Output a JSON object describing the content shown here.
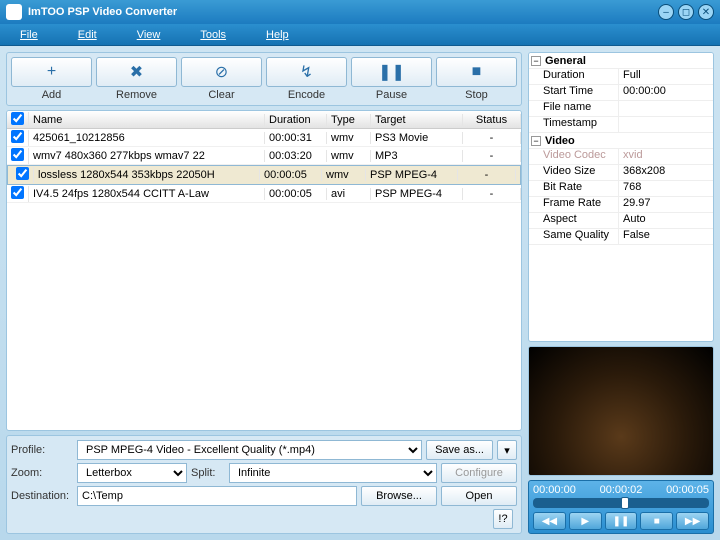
{
  "title": "ImTOO PSP Video Converter",
  "menu": [
    "File",
    "Edit",
    "View",
    "Tools",
    "Help"
  ],
  "tools": [
    {
      "icon": "+",
      "label": "Add"
    },
    {
      "icon": "✖",
      "label": "Remove"
    },
    {
      "icon": "⊘",
      "label": "Clear"
    },
    {
      "icon": "↯",
      "label": "Encode"
    },
    {
      "icon": "❚❚",
      "label": "Pause"
    },
    {
      "icon": "■",
      "label": "Stop"
    }
  ],
  "list": {
    "headers": {
      "name": "Name",
      "duration": "Duration",
      "type": "Type",
      "target": "Target",
      "status": "Status"
    },
    "rows": [
      {
        "checked": true,
        "name": "425061_10212856",
        "duration": "00:00:31",
        "type": "wmv",
        "target": "PS3 Movie",
        "status": "-"
      },
      {
        "checked": true,
        "name": "wmv7 480x360 277kbps wmav7 22",
        "duration": "00:03:20",
        "type": "wmv",
        "target": "MP3",
        "status": "-"
      },
      {
        "checked": true,
        "name": "lossless 1280x544 353kbps 22050H",
        "duration": "00:00:05",
        "type": "wmv",
        "target": "PSP MPEG-4",
        "status": "-",
        "selected": true
      },
      {
        "checked": true,
        "name": "IV4.5 24fps 1280x544 CCITT A-Law",
        "duration": "00:00:05",
        "type": "avi",
        "target": "PSP MPEG-4",
        "status": "-"
      }
    ]
  },
  "bottom": {
    "profile_label": "Profile:",
    "profile_value": "PSP MPEG-4 Video - Excellent Quality  (*.mp4)",
    "saveas": "Save as...",
    "configure": "Configure",
    "zoom_label": "Zoom:",
    "zoom_value": "Letterbox",
    "split_label": "Split:",
    "split_value": "Infinite",
    "dest_label": "Destination:",
    "dest_value": "C:\\Temp",
    "browse": "Browse...",
    "open": "Open",
    "help": "!?"
  },
  "props": {
    "general_label": "General",
    "general": [
      [
        "Duration",
        "Full"
      ],
      [
        "Start Time",
        "00:00:00"
      ],
      [
        "File name",
        ""
      ],
      [
        "Timestamp",
        ""
      ]
    ],
    "video_label": "Video",
    "video_codec": [
      "Video Codec",
      "xvid"
    ],
    "video": [
      [
        "Video Size",
        "368x208"
      ],
      [
        "Bit Rate",
        "768"
      ],
      [
        "Frame Rate",
        "29.97"
      ],
      [
        "Aspect",
        "Auto"
      ],
      [
        "Same Quality",
        "False"
      ]
    ]
  },
  "player": {
    "t0": "00:00:00",
    "t1": "00:00:02",
    "t2": "00:00:05"
  }
}
